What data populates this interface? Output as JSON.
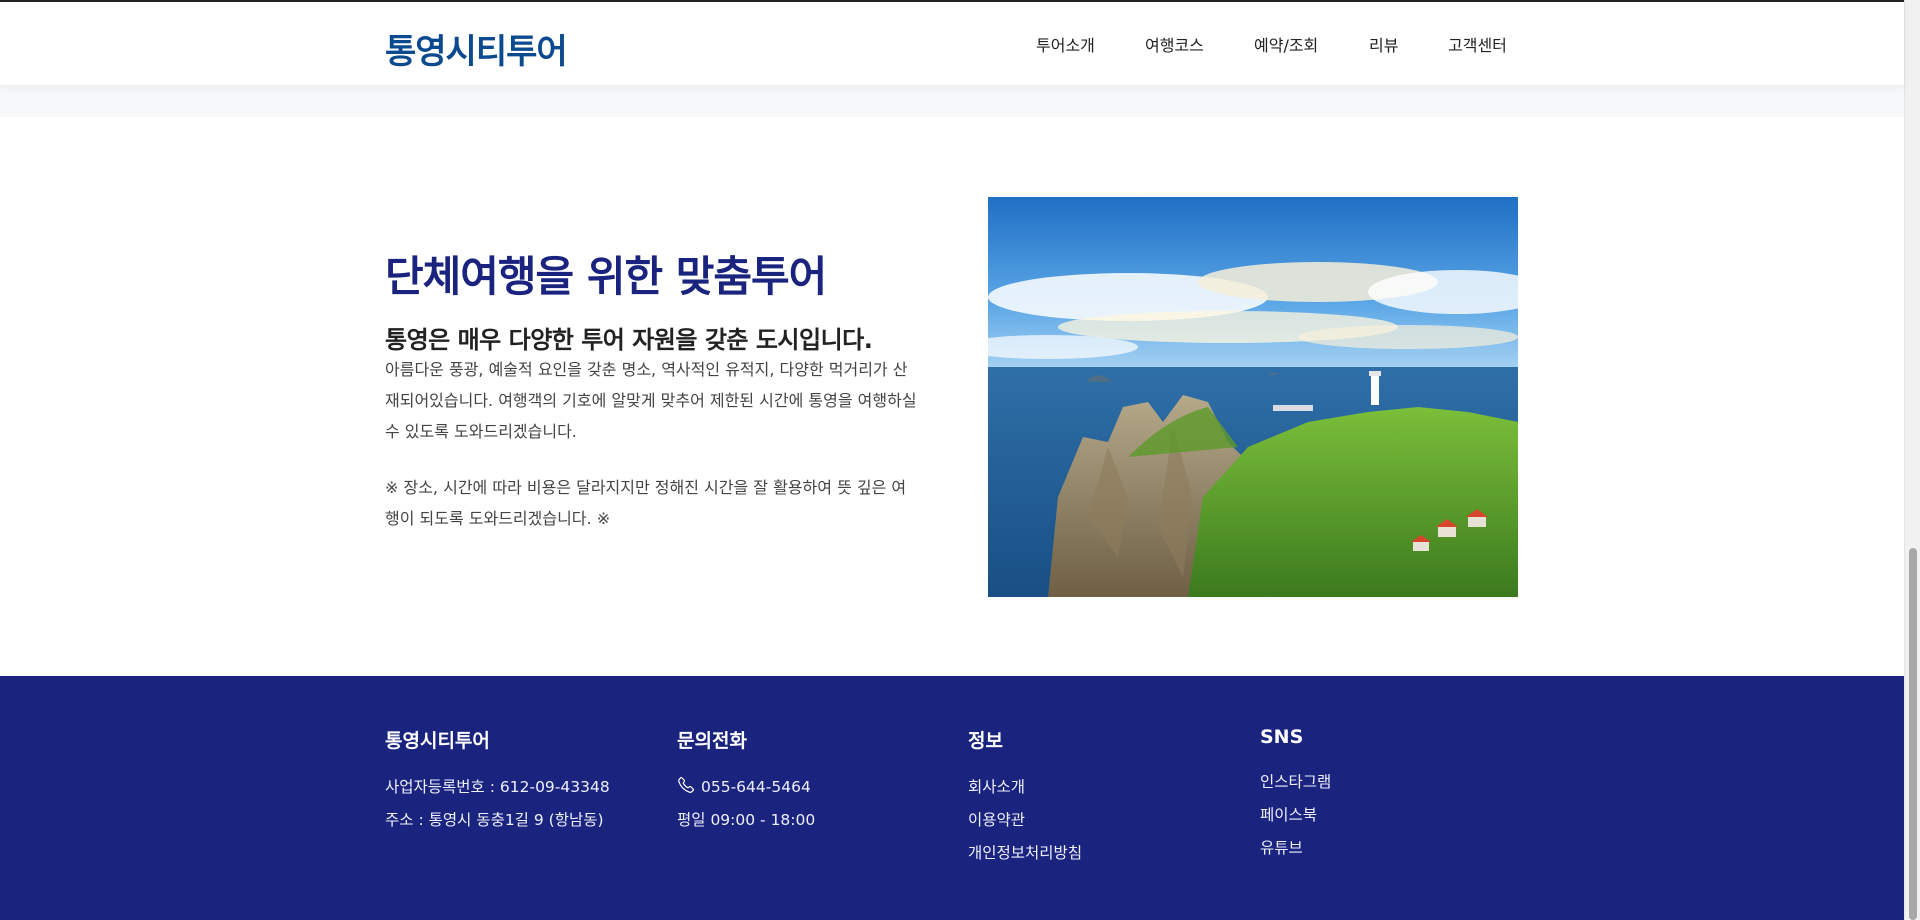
{
  "header": {
    "logo": "통영시티투어",
    "nav": [
      "투어소개",
      "여행코스",
      "예약/조회",
      "리뷰",
      "고객센터"
    ]
  },
  "section": {
    "title": "단체여행을 위한 맞춤투어",
    "subtitle": "통영은 매우 다양한 투어 자원을 갖춘 도시입니다.",
    "para1": "아름다운 풍광, 예술적 요인을 갖춘 명소, 역사적인 유적지, 다양한 먹거리가 산재되어있습니다. 여행객의 기호에 알맞게 맞추어 제한된 시간에 통영을 여행하실 수 있도록 도와드리겠습니다.",
    "para2": "※ 장소, 시간에 따라 비용은 달라지지만 정해진 시간을 잘 활용하여 뜻 깊은 여행이 되도록 도와드리겠습니다. ※"
  },
  "footer": {
    "company": {
      "heading": "통영시티투어",
      "reg": "사업자등록번호 : 612-09-43348",
      "address": "주소 : 통영시 동충1길 9 (항남동)"
    },
    "contact": {
      "heading": "문의전화",
      "phone": "055-644-5464",
      "hours": "평일 09:00 - 18:00"
    },
    "info": {
      "heading": "정보",
      "links": [
        "회사소개",
        "이용약관",
        "개인정보처리방침"
      ]
    },
    "sns": {
      "heading": "SNS",
      "links": [
        "인스타그램",
        "페이스북",
        "유튜브"
      ]
    }
  },
  "colors": {
    "brand_navy": "#1a237e",
    "logo_blue": "#0b4a8f"
  },
  "icons": {
    "phone": "phone-icon"
  }
}
